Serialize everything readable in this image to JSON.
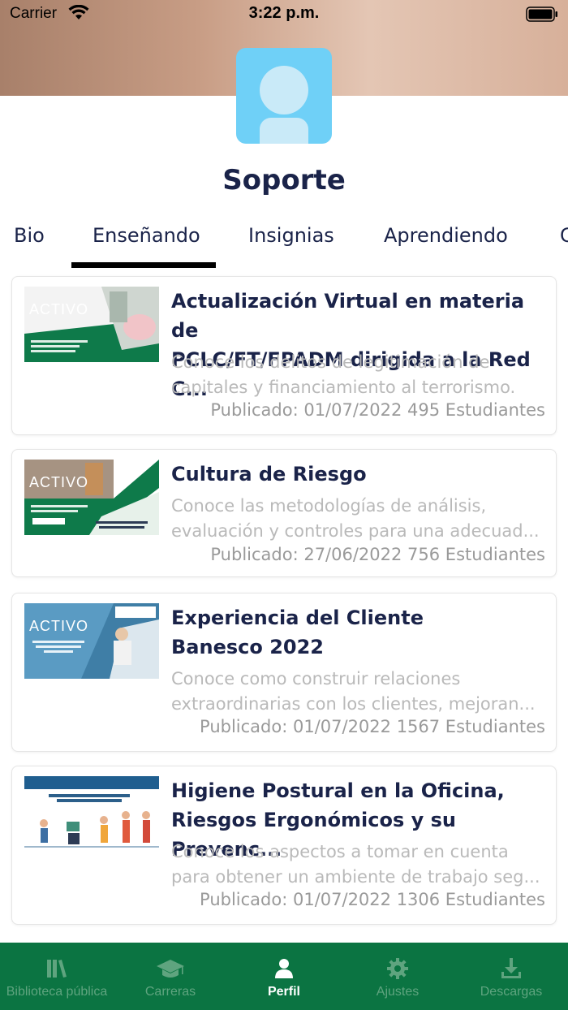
{
  "status": {
    "carrier": "Carrier",
    "time": "3:22 p.m."
  },
  "profile": {
    "name": "Soporte"
  },
  "tabs": [
    {
      "label": "Bio"
    },
    {
      "label": "Enseñando"
    },
    {
      "label": "Insignias"
    },
    {
      "label": "Aprendiendo"
    },
    {
      "label": "C"
    }
  ],
  "courses": [
    {
      "title_line1": "Actualización Virtual en materia de",
      "title_line2": "PCLC/FT/FPADM dirigida a la Red C...",
      "desc_line1": "Conoce los delitos de legitimación de",
      "desc_line2": "capitales y financiamiento al terrorismo.",
      "meta": "Publicado: 01/07/2022 495 Estudiantes",
      "badge": "ACTIVO"
    },
    {
      "title_line1": "Cultura de Riesgo",
      "desc_line1": "Conoce las metodologías de análisis,",
      "desc_line2": "evaluación y controles para una adecuad...",
      "meta": "Publicado: 27/06/2022 756 Estudiantes",
      "badge": "ACTIVO"
    },
    {
      "title_line1": "Experiencia del Cliente",
      "title_line2": "Banesco 2022",
      "desc_line1": "Conoce como construir relaciones",
      "desc_line2": "extraordinarias con los clientes, mejoran...",
      "meta": "Publicado: 01/07/2022 1567 Estudiantes",
      "badge": "ACTIVO"
    },
    {
      "title_line1": "Higiene Postural en la Oficina,",
      "title_line2": "Riesgos Ergonómicos y su Prevenc...",
      "desc_line1": "Conoce los aspectos a tomar en cuenta",
      "desc_line2": "para obtener un ambiente de trabajo seg...",
      "meta": "Publicado: 01/07/2022 1306 Estudiantes"
    }
  ],
  "tabbar": [
    {
      "label": "Biblioteca pública",
      "icon": "library-icon"
    },
    {
      "label": "Carreras",
      "icon": "graduation-cap-icon"
    },
    {
      "label": "Perfil",
      "icon": "person-icon"
    },
    {
      "label": "Ajustes",
      "icon": "gear-icon"
    },
    {
      "label": "Descargas",
      "icon": "download-icon"
    }
  ],
  "colors": {
    "tabbar_bg": "#0b7442",
    "title": "#1a2349",
    "avatar_bg": "#6fd0f7"
  }
}
